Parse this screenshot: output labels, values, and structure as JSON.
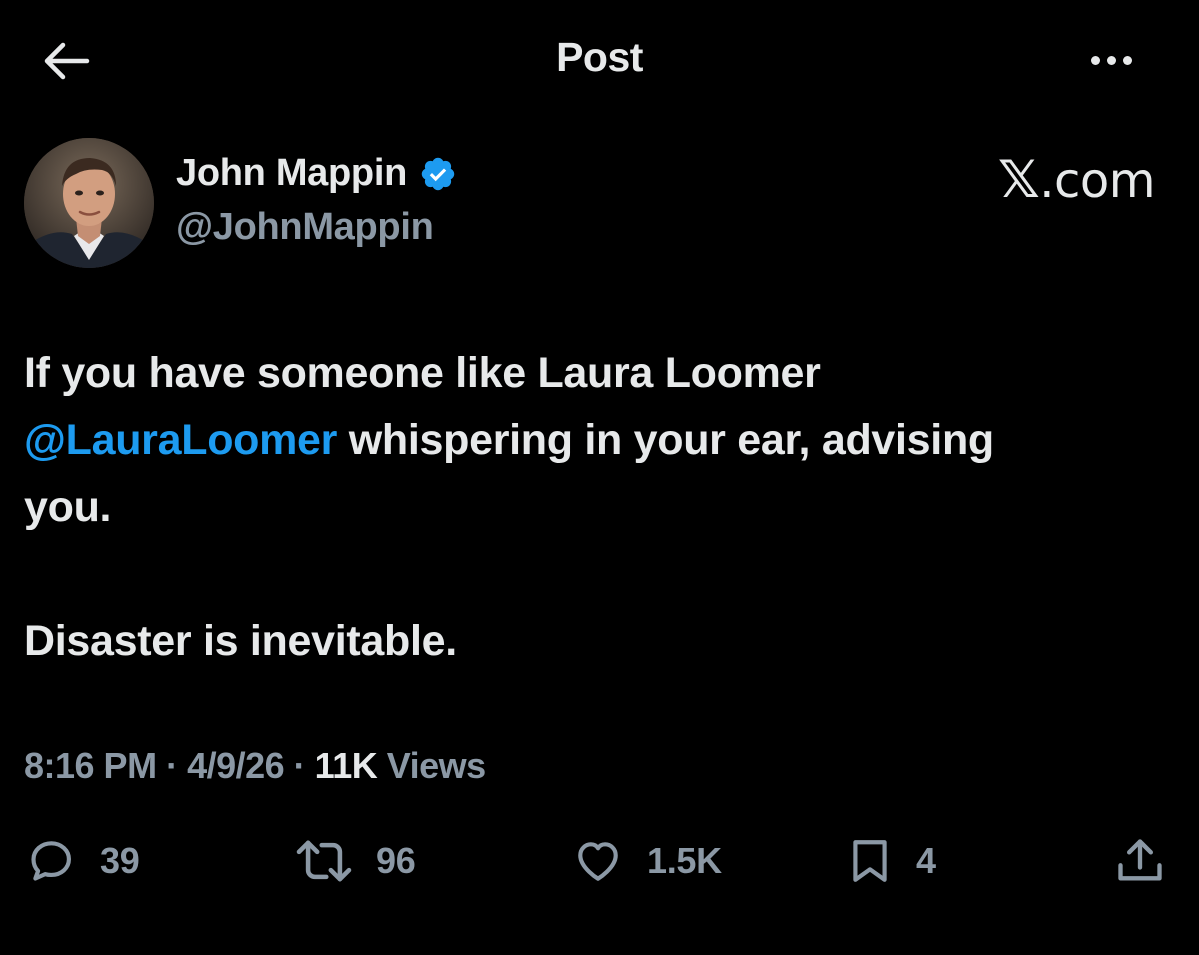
{
  "header": {
    "title": "Post"
  },
  "author": {
    "display_name": "John Mappin",
    "handle": "@JohnMappin",
    "verified": true,
    "verified_color": "#1d9bf0"
  },
  "watermark": {
    "glyph": "𝕏",
    "suffix": ".com"
  },
  "tweet": {
    "line1": "If you have someone like Laura Loomer",
    "mention": "@LauraLoomer",
    "line2_rest": " whispering in your ear, advising",
    "line3": "you.",
    "line4": "Disaster is inevitable."
  },
  "meta": {
    "time": "8:16 PM",
    "separator": " · ",
    "date": "4/9/26",
    "views_count": "11K",
    "views_label": " Views"
  },
  "actions": {
    "replies": "39",
    "reposts": "96",
    "likes": "1.5K",
    "bookmarks": "4"
  },
  "colors": {
    "background": "#000000",
    "text": "#e7e9ea",
    "secondary": "#8b98a5",
    "accent": "#1d9bf0"
  }
}
